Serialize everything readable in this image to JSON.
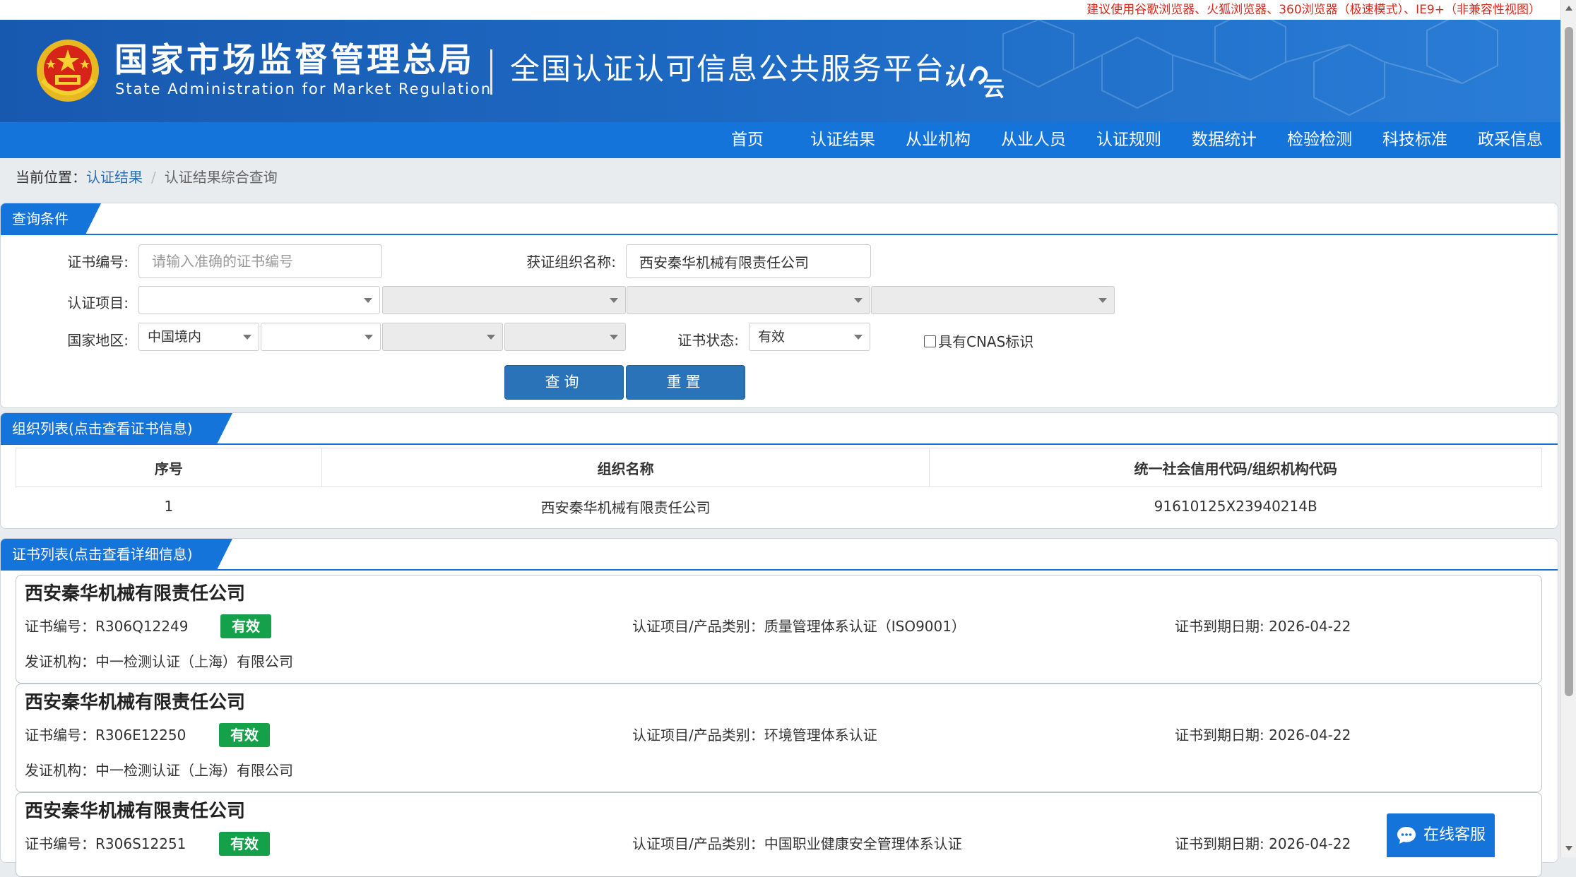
{
  "notice": "建议使用谷歌浏览器、火狐浏览器、360浏览器（极速模式）、IE9+（非兼容性视图）",
  "header": {
    "agency_cn": "国家市场监督管理总局",
    "agency_en": "State Administration  for  Market Regulation",
    "platform": "全国认证认可信息公共服务平台",
    "logo_text": "认云"
  },
  "nav": [
    "首页",
    "认证结果",
    "从业机构",
    "从业人员",
    "认证规则",
    "数据统计",
    "检验检测",
    "科技标准",
    "政采信息"
  ],
  "breadcrumb": {
    "prefix": "当前位置：",
    "link": "认证结果",
    "current": "认证结果综合查询"
  },
  "query": {
    "title": "查询条件",
    "cert_no_label": "证书编号:",
    "cert_no_placeholder": "请输入准确的证书编号",
    "org_label": "获证组织名称:",
    "org_value": "西安秦华机械有限责任公司",
    "project_label": "认证项目:",
    "region_label": "国家地区:",
    "region_value": "中国境内",
    "status_label": "证书状态:",
    "status_value": "有效",
    "cnas_label": "具有CNAS标识",
    "search_btn": "查询",
    "reset_btn": "重置"
  },
  "org_list": {
    "title": "组织列表(点击查看证书信息)",
    "columns": [
      "序号",
      "组织名称",
      "统一社会信用代码/组织机构代码"
    ],
    "rows": [
      [
        "1",
        "西安秦华机械有限责任公司",
        "91610125X23940214B"
      ]
    ]
  },
  "cert_list": {
    "title": "证书列表(点击查看详细信息)",
    "cert_no_prefix": "证书编号：",
    "project_prefix": "认证项目/产品类别：",
    "expire_prefix": "证书到期日期: ",
    "issuer_prefix": "发证机构：",
    "items": [
      {
        "org": "西安秦华机械有限责任公司",
        "cert_no": "R306Q12249",
        "status": "有效",
        "project": "质量管理体系认证（ISO9001）",
        "expire": "2026-04-22",
        "issuer": "中一检测认证（上海）有限公司"
      },
      {
        "org": "西安秦华机械有限责任公司",
        "cert_no": "R306E12250",
        "status": "有效",
        "project": "环境管理体系认证",
        "expire": "2026-04-22",
        "issuer": "中一检测认证（上海）有限公司"
      },
      {
        "org": "西安秦华机械有限责任公司",
        "cert_no": "R306S12251",
        "status": "有效",
        "project": "中国职业健康安全管理体系认证",
        "expire": "2026-04-22",
        "issuer": ""
      }
    ]
  },
  "chat": "在线客服",
  "colors": {
    "primary": "#1474d9",
    "badge": "#15a04a",
    "notice": "#d8281b",
    "header": "#1859b0"
  }
}
